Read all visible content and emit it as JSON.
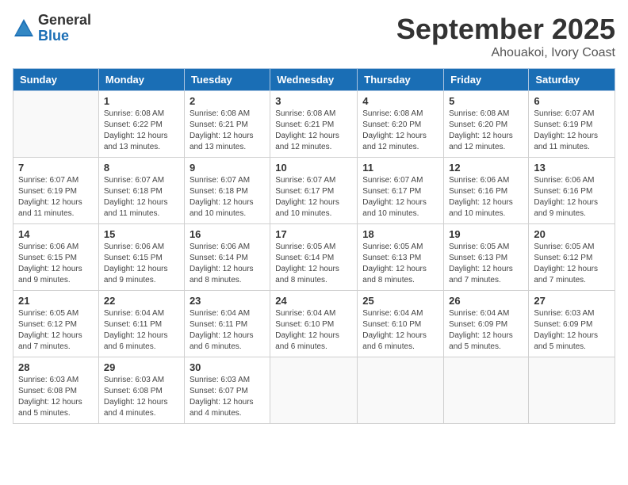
{
  "logo": {
    "general": "General",
    "blue": "Blue"
  },
  "title": "September 2025",
  "location": "Ahouakoi, Ivory Coast",
  "weekdays": [
    "Sunday",
    "Monday",
    "Tuesday",
    "Wednesday",
    "Thursday",
    "Friday",
    "Saturday"
  ],
  "weeks": [
    [
      {
        "day": "",
        "info": ""
      },
      {
        "day": "1",
        "info": "Sunrise: 6:08 AM\nSunset: 6:22 PM\nDaylight: 12 hours\nand 13 minutes."
      },
      {
        "day": "2",
        "info": "Sunrise: 6:08 AM\nSunset: 6:21 PM\nDaylight: 12 hours\nand 13 minutes."
      },
      {
        "day": "3",
        "info": "Sunrise: 6:08 AM\nSunset: 6:21 PM\nDaylight: 12 hours\nand 12 minutes."
      },
      {
        "day": "4",
        "info": "Sunrise: 6:08 AM\nSunset: 6:20 PM\nDaylight: 12 hours\nand 12 minutes."
      },
      {
        "day": "5",
        "info": "Sunrise: 6:08 AM\nSunset: 6:20 PM\nDaylight: 12 hours\nand 12 minutes."
      },
      {
        "day": "6",
        "info": "Sunrise: 6:07 AM\nSunset: 6:19 PM\nDaylight: 12 hours\nand 11 minutes."
      }
    ],
    [
      {
        "day": "7",
        "info": "Sunrise: 6:07 AM\nSunset: 6:19 PM\nDaylight: 12 hours\nand 11 minutes."
      },
      {
        "day": "8",
        "info": "Sunrise: 6:07 AM\nSunset: 6:18 PM\nDaylight: 12 hours\nand 11 minutes."
      },
      {
        "day": "9",
        "info": "Sunrise: 6:07 AM\nSunset: 6:18 PM\nDaylight: 12 hours\nand 10 minutes."
      },
      {
        "day": "10",
        "info": "Sunrise: 6:07 AM\nSunset: 6:17 PM\nDaylight: 12 hours\nand 10 minutes."
      },
      {
        "day": "11",
        "info": "Sunrise: 6:07 AM\nSunset: 6:17 PM\nDaylight: 12 hours\nand 10 minutes."
      },
      {
        "day": "12",
        "info": "Sunrise: 6:06 AM\nSunset: 6:16 PM\nDaylight: 12 hours\nand 10 minutes."
      },
      {
        "day": "13",
        "info": "Sunrise: 6:06 AM\nSunset: 6:16 PM\nDaylight: 12 hours\nand 9 minutes."
      }
    ],
    [
      {
        "day": "14",
        "info": "Sunrise: 6:06 AM\nSunset: 6:15 PM\nDaylight: 12 hours\nand 9 minutes."
      },
      {
        "day": "15",
        "info": "Sunrise: 6:06 AM\nSunset: 6:15 PM\nDaylight: 12 hours\nand 9 minutes."
      },
      {
        "day": "16",
        "info": "Sunrise: 6:06 AM\nSunset: 6:14 PM\nDaylight: 12 hours\nand 8 minutes."
      },
      {
        "day": "17",
        "info": "Sunrise: 6:05 AM\nSunset: 6:14 PM\nDaylight: 12 hours\nand 8 minutes."
      },
      {
        "day": "18",
        "info": "Sunrise: 6:05 AM\nSunset: 6:13 PM\nDaylight: 12 hours\nand 8 minutes."
      },
      {
        "day": "19",
        "info": "Sunrise: 6:05 AM\nSunset: 6:13 PM\nDaylight: 12 hours\nand 7 minutes."
      },
      {
        "day": "20",
        "info": "Sunrise: 6:05 AM\nSunset: 6:12 PM\nDaylight: 12 hours\nand 7 minutes."
      }
    ],
    [
      {
        "day": "21",
        "info": "Sunrise: 6:05 AM\nSunset: 6:12 PM\nDaylight: 12 hours\nand 7 minutes."
      },
      {
        "day": "22",
        "info": "Sunrise: 6:04 AM\nSunset: 6:11 PM\nDaylight: 12 hours\nand 6 minutes."
      },
      {
        "day": "23",
        "info": "Sunrise: 6:04 AM\nSunset: 6:11 PM\nDaylight: 12 hours\nand 6 minutes."
      },
      {
        "day": "24",
        "info": "Sunrise: 6:04 AM\nSunset: 6:10 PM\nDaylight: 12 hours\nand 6 minutes."
      },
      {
        "day": "25",
        "info": "Sunrise: 6:04 AM\nSunset: 6:10 PM\nDaylight: 12 hours\nand 6 minutes."
      },
      {
        "day": "26",
        "info": "Sunrise: 6:04 AM\nSunset: 6:09 PM\nDaylight: 12 hours\nand 5 minutes."
      },
      {
        "day": "27",
        "info": "Sunrise: 6:03 AM\nSunset: 6:09 PM\nDaylight: 12 hours\nand 5 minutes."
      }
    ],
    [
      {
        "day": "28",
        "info": "Sunrise: 6:03 AM\nSunset: 6:08 PM\nDaylight: 12 hours\nand 5 minutes."
      },
      {
        "day": "29",
        "info": "Sunrise: 6:03 AM\nSunset: 6:08 PM\nDaylight: 12 hours\nand 4 minutes."
      },
      {
        "day": "30",
        "info": "Sunrise: 6:03 AM\nSunset: 6:07 PM\nDaylight: 12 hours\nand 4 minutes."
      },
      {
        "day": "",
        "info": ""
      },
      {
        "day": "",
        "info": ""
      },
      {
        "day": "",
        "info": ""
      },
      {
        "day": "",
        "info": ""
      }
    ]
  ]
}
